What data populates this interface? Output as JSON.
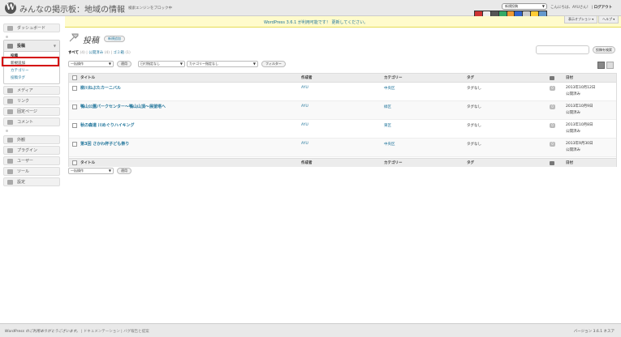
{
  "header": {
    "site_title": "みんなの掲示板：地域の情報",
    "site_link": "検索エンジンをブロック中",
    "favorites_select": "新規投稿",
    "greeting": "こんにちは、AYUさん！",
    "logout": "ログアウト"
  },
  "update_nag": {
    "text": "WordPress 3.6.1 が利用可能です！",
    "link": "更新してください。"
  },
  "screen_options": "表示オプション ▾",
  "help": "ヘルプ ▾",
  "sidebar": {
    "dashboard": "ダッシュボード",
    "posts": "投稿",
    "posts_submenu": [
      "投稿",
      "新規追加",
      "カテゴリー",
      "投稿タグ"
    ],
    "items": [
      "メディア",
      "リンク",
      "固定ページ",
      "コメント"
    ],
    "items2": [
      "外観",
      "プラグイン",
      "ユーザー",
      "ツール",
      "設定"
    ]
  },
  "main": {
    "title": "投稿",
    "add_new": "新規追加",
    "filters": {
      "all": "すべて",
      "all_count": "(4)",
      "published": "公開済み",
      "published_count": "(4)",
      "trash": "ゴミ箱",
      "trash_count": "(1)"
    },
    "search_button": "投稿を検索",
    "bulk_action": "一括操作",
    "apply": "適用",
    "date_filter": "日付指定なし",
    "category_filter": "カテゴリー指定なし",
    "filter_button": "フィルター"
  },
  "table": {
    "columns": [
      "タイトル",
      "作成者",
      "カテゴリー",
      "タグ",
      "日付"
    ],
    "rows": [
      {
        "title": "柳川ねぶたカーニバル",
        "author": "AYU",
        "category": "中央区",
        "tags": "タグなし",
        "comments": "0",
        "date": "2013年10月12日",
        "status": "公開済み"
      },
      {
        "title": "鴨山公園パークセンター〜鴨山山頂〜展望塔へ",
        "author": "AYU",
        "category": "緑区",
        "tags": "タグなし",
        "comments": "0",
        "date": "2013年10月9日",
        "status": "公開済み"
      },
      {
        "title": "秋の森道 川めぐりハイキング",
        "author": "AYU",
        "category": "東区",
        "tags": "タグなし",
        "comments": "0",
        "date": "2013年10月8日",
        "status": "公開済み"
      },
      {
        "title": "第3回 さかわ杯子ども祭り",
        "author": "AYU",
        "category": "中央区",
        "tags": "タグなし",
        "comments": "0",
        "date": "2013年9月30日",
        "status": "公開済み"
      }
    ]
  },
  "footer": {
    "left": "WordPress のご利用ありがとうございます。",
    "left_links": "| ドキュメンテーション | バグ報告と提案",
    "version": "バージョン 3.6.1 ネスア"
  },
  "colors": {
    "link": "#21759b",
    "highlight": "#d40000",
    "nag_bg": "#fffbcc"
  }
}
